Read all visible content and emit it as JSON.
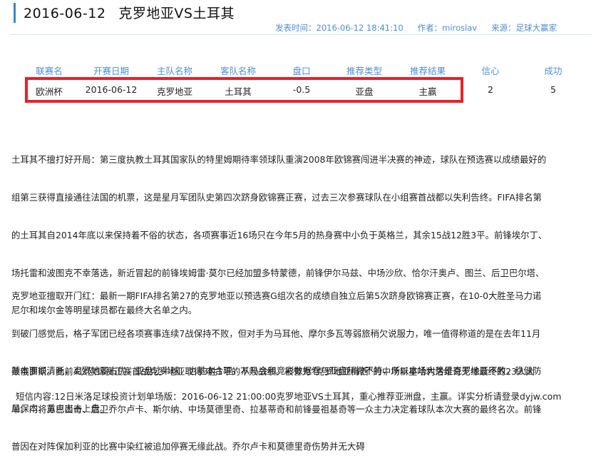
{
  "header": {
    "date": "2016-06-12",
    "match": "克罗地亚VS土耳其",
    "publish_time": "发表时间：2016-06-12 18:41:10",
    "author": "作者：miroslav",
    "source": "来源：足球大赢家"
  },
  "table": {
    "columns": [
      "联赛名",
      "开赛日期",
      "主队名称",
      "客队名称",
      "盘口",
      "推荐类型",
      "推荐结果",
      "信心",
      "成功"
    ],
    "row": [
      "欧洲杯",
      "2016-06-12",
      "克罗地亚",
      "土耳其",
      "-0.5",
      "亚盘",
      "主赢",
      "2",
      "5"
    ]
  },
  "paragraphs": [
    [
      "土耳其不擅打好开局：第三度执教土耳其国家队的特里姆期待率领球队重演2008年欧锦赛闯进半决赛的神迹，球队在预选赛以成绩最好的",
      "组第三获得直接通往法国的机票，这是星月军团队史第四次跻身欧锦赛正赛，过去三次参赛球队在小组赛首战都以失利告终。FIFA排名第",
      "的土耳其自2014年底以来保持着不俗的状态，各项赛事近16场只在今年5月的热身赛中小负于英格兰，其余15战12胜3平。前锋埃尔丁、",
      "场托雷和波图克不幸落选，新近冒起的前锋埃姆雷·莫尔已经加盟多特蒙德，前锋伊尔马兹、中场沙欣、恰尔汗奥卢、图兰、后卫巴尔塔、",
      "尼尔和埃尔金等明星球员都在最终大名单之内。"
    ],
    [
      "克罗地亚擅取开门红：最新一期FIFA排名第27的克罗地亚以预选赛G组次名的成绩自独立后第5次跻身欧锦赛正赛，在10-0大胜圣马力诺",
      "到破门感觉后，格子军团已经各项赛事连续7战保持不败，但对手为马耳他、摩尔多瓦等弱旅稍欠说服力，唯一值得称道的是在去年11月",
      "败俄罗斯。此前4次欧锦赛正赛首战克罗地亚取得3胜1平的不败战绩。被誉为“克罗地亚梅西”的中场新星哈利洛维奇无缘最终的23人大",
      "单。门将苏巴西奇、后卫乔尔卢卡、斯尔纳、中场莫德里奇、拉基蒂奇和前锋曼祖基奇等一众主力决定着球队本次大赛的最终名次。前锋",
      "普因在对阵保加利亚的比赛中染红被追加停赛无缘此战。乔尔卢卡和莫德里奇伤势并无大碍"
    ],
    [
      " 基本面很清晰，克罗地亚占优，亚盘让半球，也基本合理，从马会和竞彩数据看与亚盘稍微不符，所以本场大势是克罗地亚不败，稳健防",
      "局保本，重点出击上盘。"
    ]
  ],
  "footer": {
    "sms": "短信内容:12日米洛足球投资计划单场版：2016-06-12 21:00:00克罗地亚VS土耳其，重心推荐亚洲盘，主赢。详实分析请登录dyjw.com"
  },
  "colors": {
    "accent": "#4f8fcf",
    "title_bar": "#3b86c6",
    "highlight_border": "#e8202a"
  }
}
